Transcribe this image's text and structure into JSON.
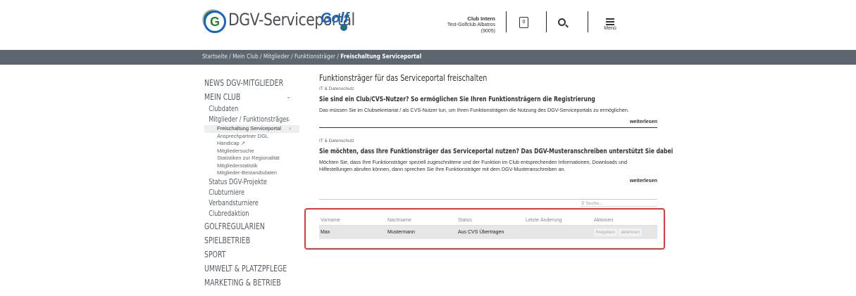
{
  "header": {
    "logo_text": "DGV-Serviceportal",
    "golf_badge": "Golf",
    "club_intern_title": "Club Intern",
    "club_name": "Test-Golfclub Albatros",
    "club_id": "(9005)",
    "doc_glyph": "0",
    "menu_label": "Menü"
  },
  "breadcrumb": {
    "items": [
      "Startseite",
      "Mein Club",
      "Mitglieder",
      "Funktionsträger"
    ],
    "separator": " / ",
    "current": "Freischaltung Serviceportal"
  },
  "sidebar": {
    "news": "NEWS DGV-MITGLIEDER",
    "mein_club": "MEIN CLUB",
    "clubdaten": "Clubdaten",
    "mitglieder": "Mitglieder / Funktionsträger",
    "leaves": [
      "Freischaltung Serviceportal",
      "Ansprechpartner DGL",
      "Handicap",
      "Mitgliedersuche",
      "Statistiken zur Regionalität",
      "Mitgliederstatistik",
      "Mitglieder-Bestandsdaten"
    ],
    "status_projekte": "Status DGV-Projekte",
    "clubturniere": "Clubturniere",
    "verbandsturniere": "Verbandsturniere",
    "clubredaktion": "Clubredaktion",
    "golfregularien": "GOLFREGULARIEN",
    "spielbetrieb": "SPIELBETRIEB",
    "sport": "SPORT",
    "umwelt": "UMWELT & PLATZPFLEGE",
    "marketing": "MARKETING & BETRIEB"
  },
  "main": {
    "title": "Funktionsträger für das Serviceportal freischalten",
    "block1": {
      "tag": "IT & Datenschutz",
      "heading": "Sie sind ein Club/CVS-Nutzer? So ermöglichen Sie Ihren Funktionsträgern die Registrierung",
      "text": "Das müssen Sie im Clubsekretariat / als CVS-Nutzer tun, um Ihren Funktionsträgern die Nutzung des DGV-Serviceportals zu ermöglichen.",
      "more": "weiterlesen"
    },
    "block2": {
      "tag": "IT & Datenschutz",
      "heading": "Sie möchten, dass Ihre Funktionsträger das Serviceportal nutzen? Das DGV-Musteranschreiben unterstützt Sie dabei",
      "text": "Möchten Sie, dass Ihre Funktionsträger speziell zugeschnittene und der Funktion im Club entsprechenden Informationen, Downloads und Hilfestellungen abrufen können, dann sprechen Sie Ihre Funktionsträger mit dem DGV-Musteranschreiben an.",
      "more": "weiterlesen"
    },
    "search_placeholder": "Suche..."
  },
  "table": {
    "columns": [
      "Vorname",
      "Nachname",
      "Status",
      "Letzte Änderung",
      "Aktionen"
    ],
    "rows": [
      {
        "vorname": "Max",
        "nachname": "Mustermann",
        "status": "Aus CVS Übertragen",
        "letzte": "",
        "approve": "freigeben",
        "reject": "ablehnen"
      }
    ]
  },
  "colors": {
    "highlight": "#e53935",
    "crumbbar": "#5d6670",
    "brand_green": "#2e7d32",
    "brand_blue": "#1565c0"
  },
  "icons": [
    "dgv-logo-icon",
    "golf-logo-icon",
    "document-icon",
    "search-icon",
    "menu-icon",
    "chevron-down-icon",
    "chevron-right-icon",
    "external-link-icon"
  ]
}
